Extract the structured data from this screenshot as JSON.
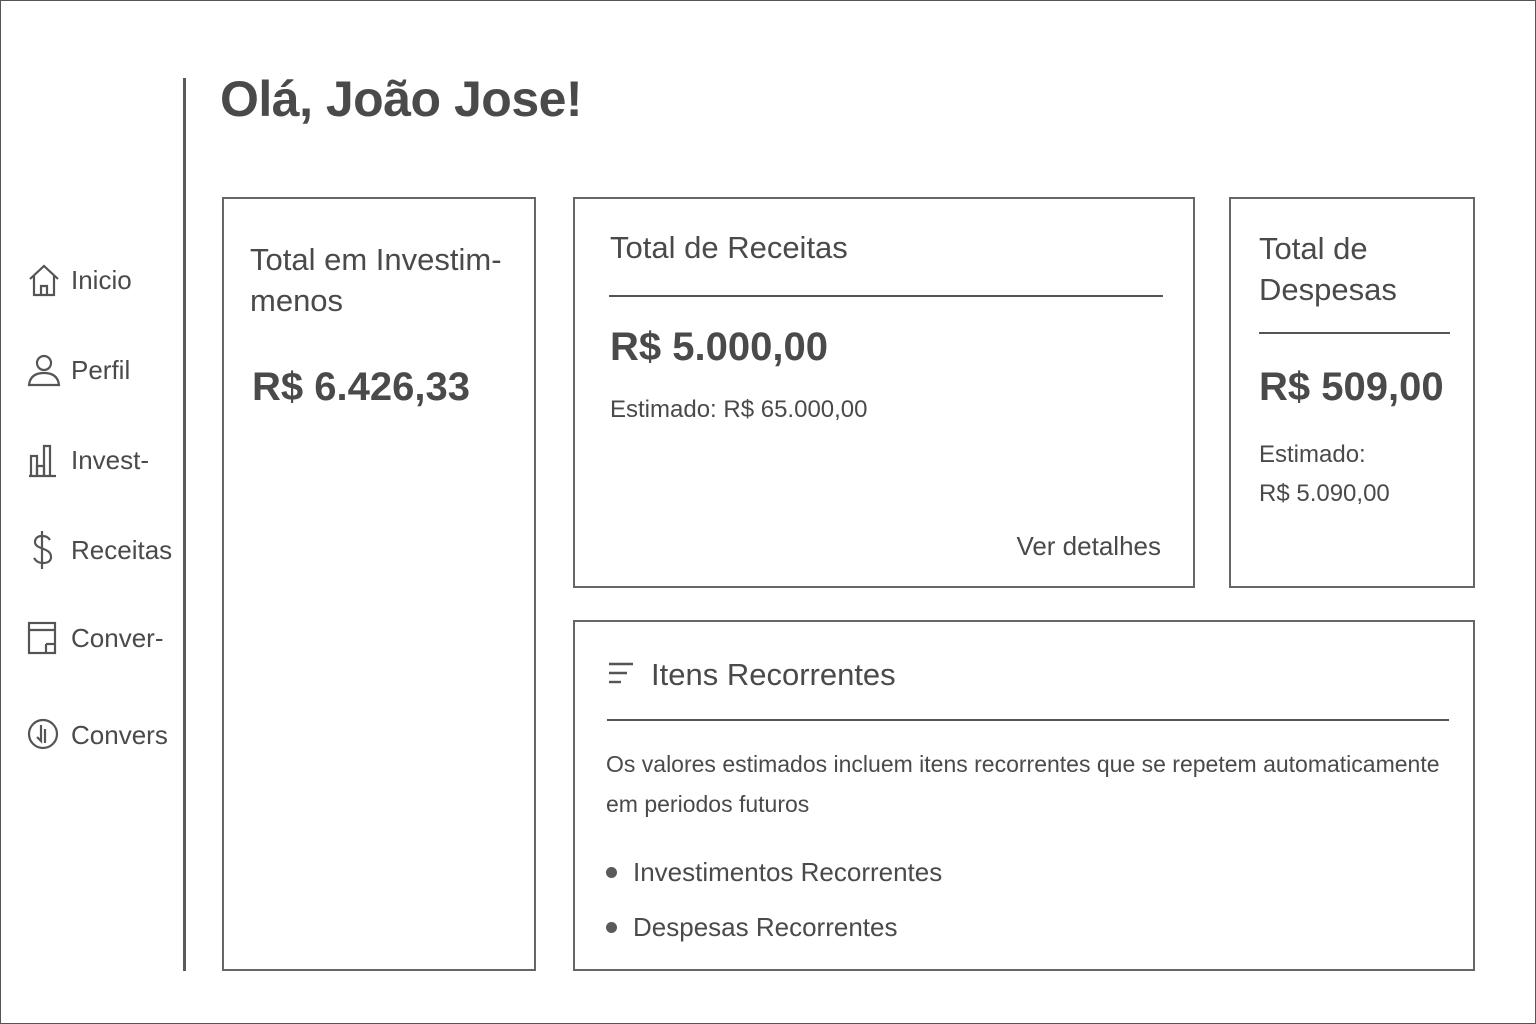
{
  "greeting": "Olá, João Jose!",
  "sidebar": {
    "items": [
      {
        "label": "Inicio",
        "icon": "home-icon"
      },
      {
        "label": "Perfil",
        "icon": "user-icon"
      },
      {
        "label": "Invest-",
        "icon": "bar-chart-icon"
      },
      {
        "label": "Receitas",
        "icon": "dollar-icon"
      },
      {
        "label": "Conver-",
        "icon": "wallet-icon"
      },
      {
        "label": "Convers",
        "icon": "convert-icon"
      }
    ]
  },
  "cards": {
    "investimentos": {
      "title": "Total em Investim-\nmenos",
      "amount": "R$ 6.426,33"
    },
    "receitas": {
      "title": "Total de Receitas",
      "amount": "R$ 5.000,00",
      "estimate": "Estimado: R$ 65.000,00",
      "link": "Ver detalhes"
    },
    "despesas": {
      "title": "Total de\nDespesas",
      "amount": "R$ 509,00",
      "estimate_label": "Estimado:",
      "estimate_value": "R$ 5.090,00"
    }
  },
  "recorrentes": {
    "icon": "list-icon",
    "title": "Itens Recorrentes",
    "description": "Os valores estimados incluem itens recorrentes que se repetem automaticamente em periodos futuros",
    "items": [
      "Investimentos Recorrentes",
      "Despesas Recorrentes"
    ]
  }
}
